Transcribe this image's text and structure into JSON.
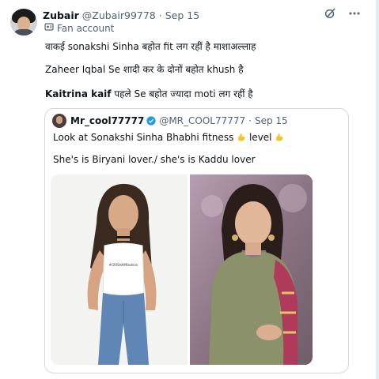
{
  "tweet": {
    "author_name": "Zubair",
    "author_handle": "@Zubair99778",
    "separator": "·",
    "timestamp": "Sep 15",
    "fan_label": "Fan account",
    "lines": [
      {
        "bold": "",
        "text": "वाकई sonakshi Sinha बहोत fit लग रहीं है माशाअल्लाह"
      },
      {
        "bold": "",
        "text": "Zaheer Iqbal Se शादी कर के दोनों बहोत khush है"
      },
      {
        "bold": "Kaitrina kaif",
        "text": " पहले Se बहोत ज्यादा moti लग रहीं है"
      }
    ]
  },
  "quoted": {
    "author_name": "Mr_cool77777",
    "author_handle": "@MR_COOL77777",
    "separator": "·",
    "timestamp": "Sep 15",
    "line1_a": "Look at Sonakshi Sinha Bhabhi fitness",
    "line1_b": " level",
    "line2": "She's is Biryani lover./ she's is Kaddu lover",
    "shirt_text": "#GRISHAMfashion"
  },
  "icons": {
    "grok": "grok-icon",
    "more": "more-icon",
    "fan": "fan-account-icon",
    "verified": "verified-badge-icon",
    "emoji": "flexed-biceps-emoji"
  },
  "colors": {
    "verified": "#1d9bf0",
    "muted": "#536471",
    "border": "#cfd9de"
  }
}
